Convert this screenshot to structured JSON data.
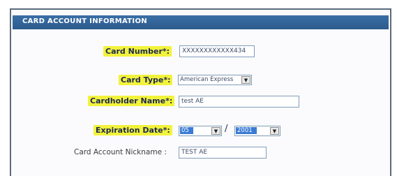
{
  "section": {
    "title": "CARD ACCOUNT INFORMATION"
  },
  "fields": {
    "card_number": {
      "label": "Card Number*:",
      "value": "XXXXXXXXXXXX434"
    },
    "card_type": {
      "label": "Card Type*:",
      "value": "American Express"
    },
    "cardholder_name": {
      "label": "Cardholder Name*:",
      "value": "test AE"
    },
    "expiration": {
      "label": "Expiration Date*:",
      "month": "05",
      "separator": "/",
      "year": "2001"
    },
    "nickname": {
      "label": "Card Account Nickname :",
      "value": "TEST AE"
    }
  },
  "colors": {
    "header": "#2d5a8c",
    "highlight": "#f2f23c",
    "label": "#1d2a52"
  }
}
